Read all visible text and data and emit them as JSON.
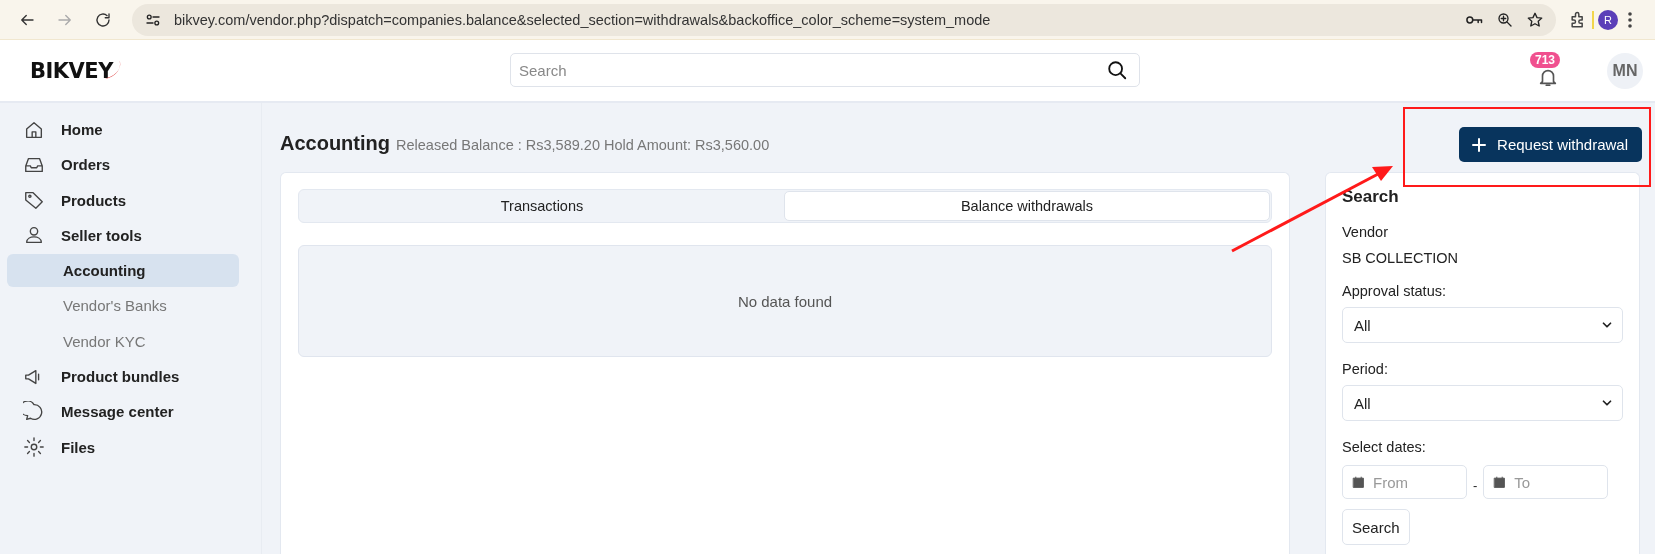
{
  "browser": {
    "url": "bikvey.com/vendor.php?dispatch=companies.balance&selected_section=withdrawals&backoffice_color_scheme=system_mode",
    "profile": "R"
  },
  "header": {
    "logo": "BIKVEY",
    "search": {
      "placeholder": "Search"
    },
    "notifications": "713",
    "avatar": "MN"
  },
  "sidebar": {
    "items": [
      {
        "label": "Home",
        "selected": false
      },
      {
        "label": "Orders",
        "selected": false
      },
      {
        "label": "Products",
        "selected": false
      },
      {
        "label": "Seller tools",
        "selected": false,
        "children": [
          {
            "label": "Accounting",
            "selected": true
          },
          {
            "label": "Vendor's Banks",
            "selected": false
          },
          {
            "label": "Vendor KYC",
            "selected": false
          }
        ]
      },
      {
        "label": "Product bundles",
        "selected": false
      },
      {
        "label": "Message center",
        "selected": false
      },
      {
        "label": "Files",
        "selected": false
      }
    ]
  },
  "page": {
    "title": "Accounting",
    "summary": "Released Balance : Rs3,589.20 Hold Amount: Rs3,560.00",
    "action": "Request withdrawal"
  },
  "tabs": [
    {
      "label": "Transactions",
      "selected": false
    },
    {
      "label": "Balance withdrawals",
      "selected": true
    }
  ],
  "empty_message": "No data found",
  "search_panel": {
    "title": "Search",
    "vendor_label": "Vendor",
    "vendor": "SB COLLECTION",
    "approval_status": {
      "label": "Approval status:",
      "value": "All"
    },
    "period": {
      "label": "Period:",
      "value": "All"
    },
    "dates": {
      "label": "Select dates:",
      "from": {
        "placeholder": "From"
      },
      "separator": "-",
      "to": {
        "placeholder": "To"
      }
    },
    "button": "Search"
  }
}
